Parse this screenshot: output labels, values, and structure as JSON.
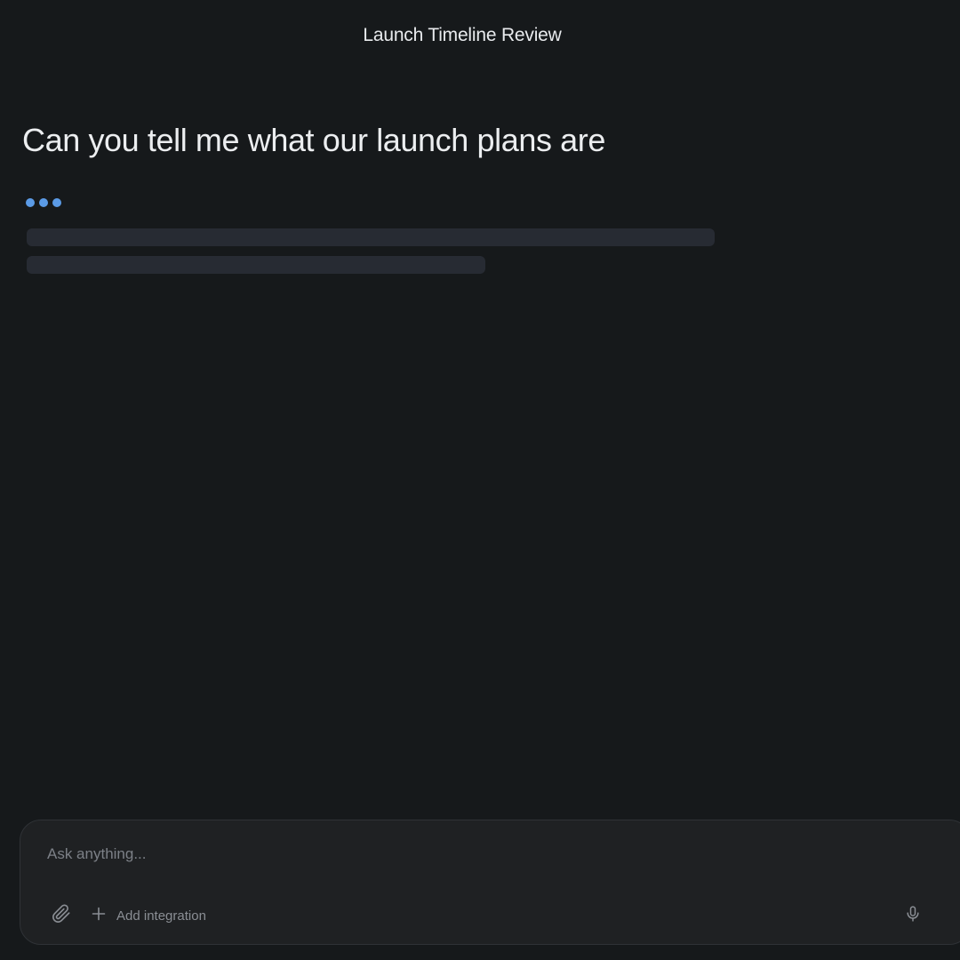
{
  "header": {
    "title": "Launch Timeline Review"
  },
  "conversation": {
    "user_message": "Can you tell me what our launch plans are",
    "assistant_state": "loading",
    "typing_indicator_color": "#5b9be6"
  },
  "composer": {
    "placeholder": "Ask anything...",
    "value": "",
    "attach_icon": "paperclip-icon",
    "add_integration_icon": "plus-icon",
    "add_integration_label": "Add integration",
    "mic_icon": "microphone-icon"
  },
  "colors": {
    "background": "#16191b",
    "composer_background": "#1f2123",
    "skeleton": "#272b33",
    "accent": "#5b9be6"
  }
}
